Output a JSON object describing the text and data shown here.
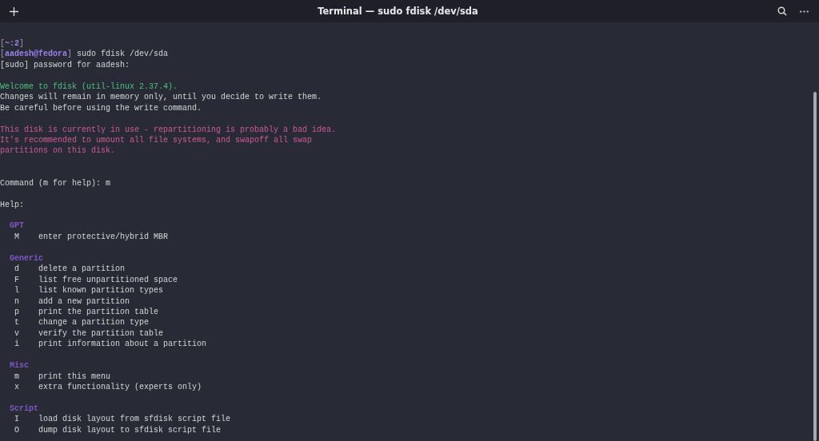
{
  "window": {
    "title": "Terminal — sudo fdisk /dev/sda"
  },
  "lines": [
    {
      "kind": "segments",
      "segments": [
        {
          "text": "[",
          "color": "#9a9aa5"
        },
        {
          "text": "~:2",
          "color": "#9d82e8"
        },
        {
          "text": "]",
          "color": "#9a9aa5"
        }
      ]
    },
    {
      "kind": "segments",
      "segments": [
        {
          "text": "[",
          "color": "#9a9aa5"
        },
        {
          "text": "aadesh@fedora",
          "color": "#9d82e8"
        },
        {
          "text": "] ",
          "color": "#9a9aa5"
        },
        {
          "text": "sudo fdisk /dev/sda",
          "color": "#d6d6d6"
        }
      ]
    },
    {
      "kind": "text",
      "text": "[sudo] password for aadesh:"
    },
    {
      "kind": "blank"
    },
    {
      "kind": "text",
      "color": "#4cc37b",
      "text": "Welcome to fdisk (util-linux 2.37.4)."
    },
    {
      "kind": "text",
      "text": "Changes will remain in memory only, until you decide to write them."
    },
    {
      "kind": "text",
      "text": "Be careful before using the write command."
    },
    {
      "kind": "blank"
    },
    {
      "kind": "text",
      "color": "#cf5b98",
      "text": "This disk is currently in use - repartitioning is probably a bad idea."
    },
    {
      "kind": "text",
      "color": "#cf5b98",
      "text": "It's recommended to umount all file systems, and swapoff all swap"
    },
    {
      "kind": "text",
      "color": "#cf5b98",
      "text": "partitions on this disk."
    },
    {
      "kind": "blank"
    },
    {
      "kind": "blank"
    },
    {
      "kind": "text",
      "text": "Command (m for help): m"
    },
    {
      "kind": "blank"
    },
    {
      "kind": "text",
      "text": "Help:"
    },
    {
      "kind": "blank"
    },
    {
      "kind": "heading",
      "text": "GPT"
    },
    {
      "kind": "option",
      "key": "M",
      "text": "enter protective/hybrid MBR"
    },
    {
      "kind": "blank"
    },
    {
      "kind": "heading",
      "text": "Generic"
    },
    {
      "kind": "option",
      "key": "d",
      "text": "delete a partition"
    },
    {
      "kind": "option",
      "key": "F",
      "text": "list free unpartitioned space"
    },
    {
      "kind": "option",
      "key": "l",
      "text": "list known partition types"
    },
    {
      "kind": "option",
      "key": "n",
      "text": "add a new partition"
    },
    {
      "kind": "option",
      "key": "p",
      "text": "print the partition table"
    },
    {
      "kind": "option",
      "key": "t",
      "text": "change a partition type"
    },
    {
      "kind": "option",
      "key": "v",
      "text": "verify the partition table"
    },
    {
      "kind": "option",
      "key": "i",
      "text": "print information about a partition"
    },
    {
      "kind": "blank"
    },
    {
      "kind": "heading",
      "text": "Misc"
    },
    {
      "kind": "option",
      "key": "m",
      "text": "print this menu"
    },
    {
      "kind": "option",
      "key": "x",
      "text": "extra functionality (experts only)"
    },
    {
      "kind": "blank"
    },
    {
      "kind": "heading",
      "text": "Script"
    },
    {
      "kind": "option",
      "key": "I",
      "text": "load disk layout from sfdisk script file"
    },
    {
      "kind": "option",
      "key": "O",
      "text": "dump disk layout to sfdisk script file"
    }
  ]
}
